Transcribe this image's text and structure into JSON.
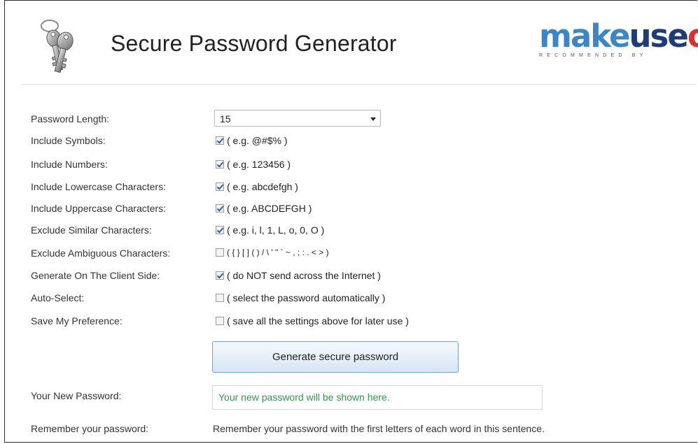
{
  "header": {
    "title": "Secure Password Generator",
    "logo": {
      "part_make": "make",
      "part_use": "use",
      "part_of": "of",
      "subtitle": "RECOMMENDED BY"
    }
  },
  "form": {
    "password_length": {
      "label": "Password Length:",
      "value": "15"
    },
    "options": [
      {
        "label": "Include Symbols:",
        "checked": true,
        "hint": "( e.g. @#$% )"
      },
      {
        "label": "Include Numbers:",
        "checked": true,
        "hint": "( e.g. 123456 )"
      },
      {
        "label": "Include Lowercase Characters:",
        "checked": true,
        "hint": "( e.g. abcdefgh )"
      },
      {
        "label": "Include Uppercase Characters:",
        "checked": true,
        "hint": "( e.g. ABCDEFGH )"
      },
      {
        "label": "Exclude Similar Characters:",
        "checked": true,
        "hint": "( e.g. i, l, 1, L, o, 0, O )"
      },
      {
        "label": "Exclude Ambiguous Characters:",
        "checked": false,
        "hint": "( { } [ ] ( ) / \\ ' \" ` ~ , ; : . < > )"
      },
      {
        "label": "Generate On The Client Side:",
        "checked": true,
        "hint": "( do NOT send across the Internet )"
      },
      {
        "label": "Auto-Select:",
        "checked": false,
        "hint": "( select the password automatically )"
      },
      {
        "label": "Save My Preference:",
        "checked": false,
        "hint": "( save all the settings above for later use )"
      }
    ],
    "generate_button": "Generate secure password",
    "new_password": {
      "label": "Your New Password:",
      "placeholder": "Your new password will be shown here."
    },
    "remember": {
      "label": "Remember your password:",
      "text": "Remember your password with the first letters of each word in this sentence."
    }
  },
  "colors": {
    "logo_make": "#3c86c8",
    "logo_use": "#1f3d74",
    "logo_of": "#d8322c",
    "password_placeholder": "#2e9a4d",
    "button_border": "#7aa2cc"
  },
  "icons": {
    "app_icon": "keys-icon",
    "select_arrow": "chevron-down-icon",
    "checkbox": "checkbox-icon"
  }
}
